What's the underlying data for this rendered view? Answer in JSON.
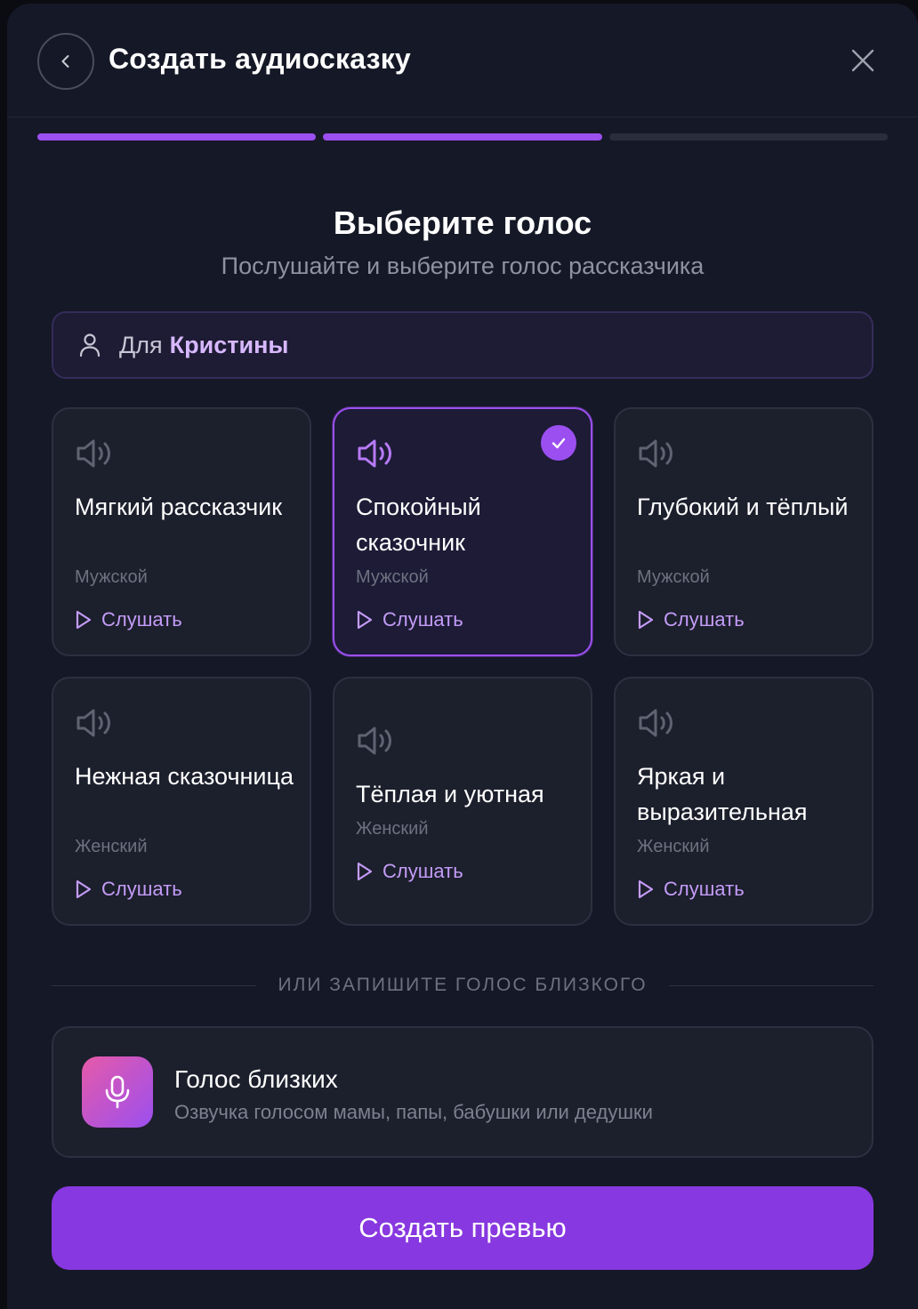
{
  "header": {
    "title": "Создать аудиосказку"
  },
  "progress": {
    "steps_total": 3,
    "steps_completed": 2
  },
  "step": {
    "title": "Выберите голос",
    "subtitle": "Послушайте и выберите голос рассказчика"
  },
  "for_banner": {
    "prefix": "Для",
    "name": "Кристины"
  },
  "voices": [
    {
      "name": "Мягкий рассказчик",
      "gender": "Мужской",
      "listen": "Слушать",
      "selected": false
    },
    {
      "name": "Спокойный сказочник",
      "gender": "Мужской",
      "listen": "Слушать",
      "selected": true
    },
    {
      "name": "Глубокий и тёплый",
      "gender": "Мужской",
      "listen": "Слушать",
      "selected": false
    },
    {
      "name": "Нежная сказочница",
      "gender": "Женский",
      "listen": "Слушать",
      "selected": false
    },
    {
      "name": "Тёплая и уютная",
      "gender": "Женский",
      "listen": "Слушать",
      "selected": false
    },
    {
      "name": "Яркая и выразительная",
      "gender": "Женский",
      "listen": "Слушать",
      "selected": false
    }
  ],
  "divider_text": "ИЛИ ЗАПИШИТЕ ГОЛОС БЛИЗКОГО",
  "family_voice": {
    "title": "Голос близких",
    "subtitle": "Озвучка голосом мамы, папы, бабушки или дедушки"
  },
  "cta_label": "Создать превью",
  "colors": {
    "accent": "#9b4ff0",
    "background": "#151826",
    "cta": "#8838e0"
  },
  "icons": {
    "back": "chevron-left-icon",
    "close": "close-icon",
    "person": "user-icon",
    "speaker": "speaker-icon",
    "play": "play-icon",
    "check": "check-icon",
    "mic": "microphone-icon"
  }
}
